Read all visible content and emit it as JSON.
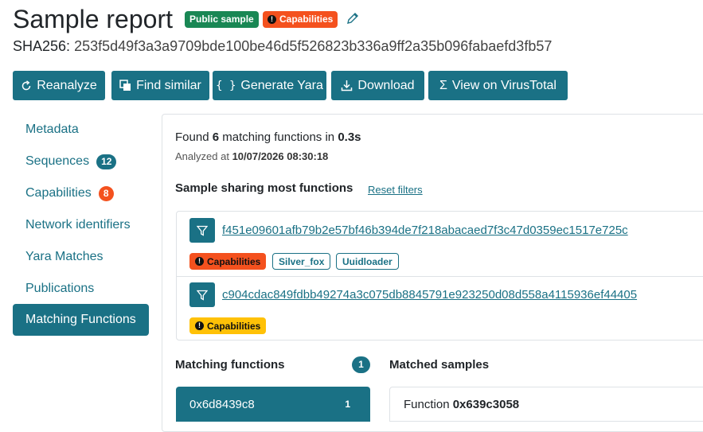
{
  "header": {
    "title": "Sample report",
    "badge_public": "Public sample",
    "badge_capabilities": "Capabilities",
    "sha_label": "SHA256:",
    "sha_value": "253f5d49f3a3a9709bde100be46d5f526823b336a9ff2a35b096fabaefd3fb57"
  },
  "toolbar": {
    "reanalyze": "Reanalyze",
    "find_similar": "Find similar",
    "generate_yara": "Generate Yara",
    "download": "Download",
    "view_virustotal": "View on VirusTotal"
  },
  "sidebar": {
    "items": [
      {
        "label": "Metadata"
      },
      {
        "label": "Sequences",
        "count": "12",
        "count_color": "#1a7185"
      },
      {
        "label": "Capabilities",
        "count": "8",
        "count_color": "#f4511e"
      },
      {
        "label": "Network identifiers"
      },
      {
        "label": "Yara Matches"
      },
      {
        "label": "Publications"
      },
      {
        "label": "Matching Functions",
        "active": true
      }
    ]
  },
  "main": {
    "found_prefix": "Found",
    "found_count": "6",
    "found_middle": "matching functions in",
    "found_time": "0.3s",
    "analyzed_prefix": "Analyzed at",
    "analyzed_value": "10/07/2026 08:30:18",
    "sharing_title": "Sample sharing most functions",
    "reset_filters": "Reset filters",
    "shared_samples": [
      {
        "hash": "f451e09601afb79b2e57bf46b394de7f218abacaed7f3c47d0359ec1517e725c",
        "tags": [
          {
            "label": "Capabilities",
            "style": "caps-red"
          },
          {
            "label": "Silver_fox",
            "style": "outline"
          },
          {
            "label": "Uuidloader",
            "style": "outline"
          }
        ]
      },
      {
        "hash": "c904cdac849fdbb49274a3c075db8845791e923250d08d558a4115936ef44405",
        "tags": [
          {
            "label": "Capabilities",
            "style": "caps-yellow"
          }
        ]
      }
    ],
    "matching_functions_title": "Matching functions",
    "matching_functions_count": "1",
    "matched_samples_title": "Matched samples",
    "function_item": {
      "address": "0x6d8439c8",
      "count": "1"
    },
    "matched_function_prefix": "Function",
    "matched_function_address": "0x639c3058"
  },
  "colors": {
    "primary": "#1a7185",
    "public_green": "#198754",
    "capabilities_orange": "#f4511e",
    "capabilities_yellow": "#ffc107"
  }
}
